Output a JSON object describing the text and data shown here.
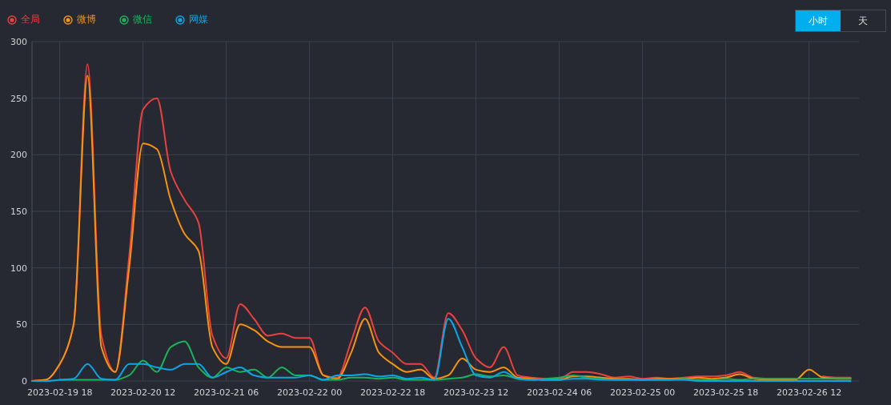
{
  "granularity": [
    {
      "label": "小时",
      "selected": true
    },
    {
      "label": "天",
      "selected": false
    }
  ],
  "chart_data": {
    "type": "line",
    "categories": [
      null,
      null,
      "2023-02-19 18",
      null,
      null,
      null,
      null,
      null,
      "2023-02-20 12",
      null,
      null,
      null,
      null,
      null,
      "2023-02-21 06",
      null,
      null,
      null,
      null,
      null,
      "2023-02-22 00",
      null,
      null,
      null,
      null,
      null,
      "2023-02-22 18",
      null,
      null,
      null,
      null,
      null,
      "2023-02-23 12",
      null,
      null,
      null,
      null,
      null,
      "2023-02-24 06",
      null,
      null,
      null,
      null,
      null,
      "2023-02-25 00",
      null,
      null,
      null,
      null,
      null,
      "2023-02-25 18",
      null,
      null,
      null,
      null,
      null,
      "2023-02-26 12",
      null,
      null,
      null
    ],
    "ylim": [
      0,
      300
    ],
    "grid": true,
    "yticks": [
      0,
      50,
      100,
      150,
      200,
      250,
      300
    ],
    "series": [
      {
        "name": "全局",
        "color": "#e8413f",
        "values": [
          0,
          1,
          15,
          50,
          280,
          40,
          8,
          110,
          240,
          250,
          185,
          160,
          140,
          40,
          20,
          68,
          55,
          40,
          42,
          38,
          38,
          5,
          3,
          35,
          65,
          35,
          25,
          15,
          15,
          3,
          60,
          45,
          20,
          12,
          30,
          5,
          3,
          2,
          2,
          8,
          8,
          6,
          3,
          4,
          2,
          3,
          2,
          3,
          4,
          4,
          5,
          8,
          3,
          2,
          2,
          2,
          null,
          4,
          3,
          3
        ]
      },
      {
        "name": "微博",
        "color": "#f7930e",
        "values": [
          0,
          1,
          15,
          50,
          270,
          30,
          8,
          100,
          210,
          205,
          160,
          130,
          115,
          30,
          15,
          50,
          45,
          35,
          30,
          30,
          30,
          5,
          2,
          25,
          55,
          25,
          15,
          8,
          10,
          2,
          5,
          20,
          10,
          8,
          12,
          3,
          2,
          1,
          1,
          4,
          4,
          3,
          2,
          2,
          1,
          2,
          2,
          2,
          3,
          2,
          3,
          6,
          2,
          1,
          1,
          1,
          10,
          3,
          2,
          2
        ]
      },
      {
        "name": "微信",
        "color": "#1bb35a",
        "values": [
          null,
          null,
          1,
          1,
          1,
          1,
          1,
          5,
          18,
          8,
          30,
          35,
          12,
          3,
          12,
          8,
          10,
          3,
          12,
          5,
          5,
          1,
          1,
          3,
          3,
          2,
          3,
          1,
          1,
          1,
          2,
          3,
          6,
          4,
          5,
          2,
          1,
          2,
          3,
          5,
          3,
          2,
          1,
          1,
          1,
          1,
          1,
          2,
          1,
          1,
          2,
          1,
          2,
          2,
          2,
          2,
          2,
          2,
          2,
          2
        ]
      },
      {
        "name": "网媒",
        "color": "#0ba6e8",
        "values": [
          0,
          0,
          1,
          2,
          15,
          2,
          1,
          15,
          15,
          12,
          10,
          15,
          15,
          3,
          8,
          12,
          5,
          3,
          3,
          3,
          5,
          1,
          5,
          5,
          6,
          4,
          5,
          2,
          3,
          1,
          55,
          30,
          5,
          3,
          8,
          2,
          1,
          1,
          1,
          2,
          2,
          1,
          1,
          1,
          1,
          1,
          1,
          1,
          0,
          0,
          0,
          0,
          0,
          0,
          0,
          0,
          0,
          0,
          0,
          0
        ]
      }
    ]
  }
}
